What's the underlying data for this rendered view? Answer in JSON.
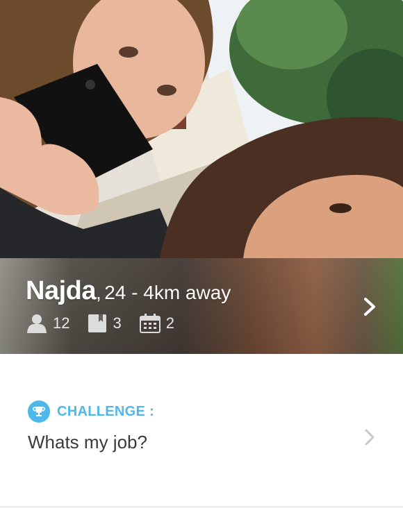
{
  "profile": {
    "name": "Najda",
    "age_distance": "24 - 4km away",
    "separator": ",",
    "stats": {
      "friends": "12",
      "books": "3",
      "events": "2"
    }
  },
  "challenge": {
    "label": "CHALLENGE :",
    "question": "Whats my job?"
  },
  "icons": {
    "friends": "person-icon",
    "books": "book-icon",
    "events": "calendar-icon",
    "challenge": "trophy-icon",
    "more": "chevron-right-icon"
  },
  "colors": {
    "accent": "#4fb8ea",
    "text": "#3a3a3a",
    "white": "#ffffff"
  }
}
